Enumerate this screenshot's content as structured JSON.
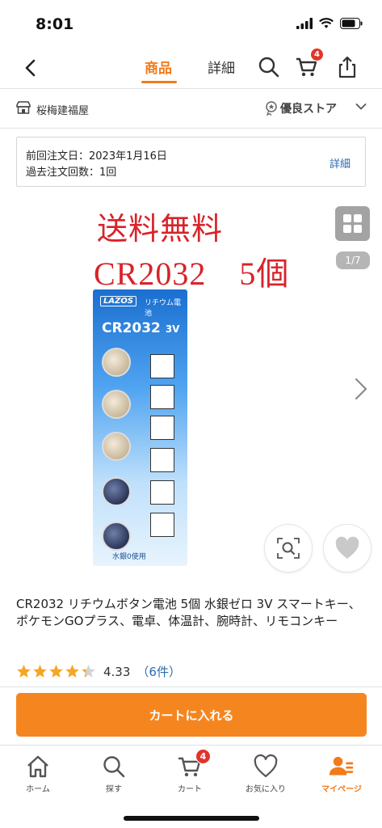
{
  "status": {
    "time": "8:01"
  },
  "nav": {
    "tab_product": "商品",
    "tab_detail": "詳細",
    "cart_count": "4"
  },
  "store": {
    "name": "桜梅建福屋",
    "badge": "優良ストア"
  },
  "order": {
    "last_order": "前回注文日：2023年1月16日",
    "order_count": "過去注文回数：1回",
    "detail_link": "詳細"
  },
  "gallery": {
    "promo_line1": "送料無料",
    "promo_line2": "CR2032　5個",
    "page": "1/7",
    "brand": "LAZOS",
    "product_type_jp": "リチウム電池",
    "model": "CR2032",
    "voltage": "3V",
    "bottom_note": "水銀0使用"
  },
  "product": {
    "title": "CR2032 リチウムボタン電池 5個 水銀ゼロ 3V スマートキー、ポケモンGOプラス、電卓、体温計、腕時計、リモコンキー",
    "rating": "4.33",
    "review_count": "（6件）",
    "stars": 4.33
  },
  "cta": {
    "label": "カートに入れる"
  },
  "tabbar": {
    "items": [
      {
        "label": "ホーム",
        "icon": "home-icon"
      },
      {
        "label": "探す",
        "icon": "search-icon"
      },
      {
        "label": "カート",
        "icon": "cart-icon"
      },
      {
        "label": "お気に入り",
        "icon": "heart-icon"
      },
      {
        "label": "マイページ",
        "icon": "person-icon"
      }
    ],
    "cart_badge": "4"
  },
  "colors": {
    "accent": "#f27a1a",
    "cta": "#f5861f",
    "promo_red": "#d8232a",
    "link": "#2a6ab0",
    "badge": "#e0352b",
    "star": "#f5a623"
  }
}
